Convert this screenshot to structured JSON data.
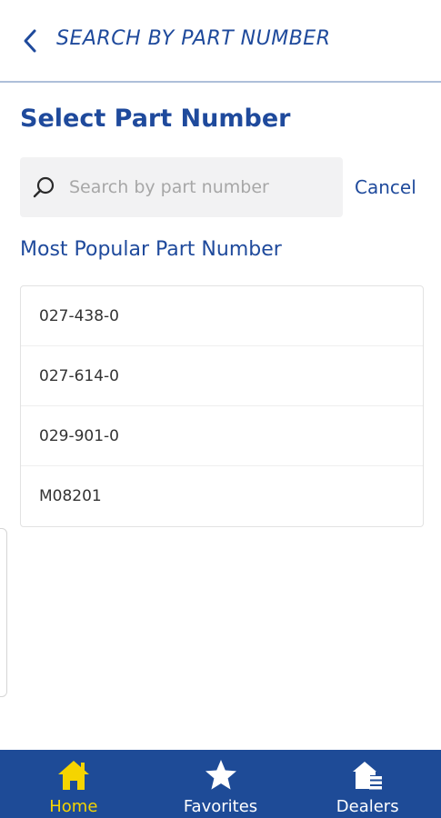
{
  "header": {
    "title": "SEARCH BY PART NUMBER"
  },
  "page": {
    "title": "Select Part Number"
  },
  "search": {
    "placeholder": "Search by part number",
    "value": "",
    "cancel_label": "Cancel"
  },
  "popular": {
    "heading": "Most Popular Part Number",
    "items": [
      {
        "label": "027-438-0"
      },
      {
        "label": "027-614-0"
      },
      {
        "label": "029-901-0"
      },
      {
        "label": "M08201"
      }
    ]
  },
  "bottom_nav": {
    "items": [
      {
        "label": "Home",
        "icon": "home-icon",
        "active": true
      },
      {
        "label": "Favorites",
        "icon": "star-icon",
        "active": false
      },
      {
        "label": "Dealers",
        "icon": "dealers-icon",
        "active": false
      }
    ]
  },
  "colors": {
    "brand_blue": "#1f4a9c",
    "nav_blue": "#1e4b97",
    "active_yellow": "#f5d400"
  }
}
